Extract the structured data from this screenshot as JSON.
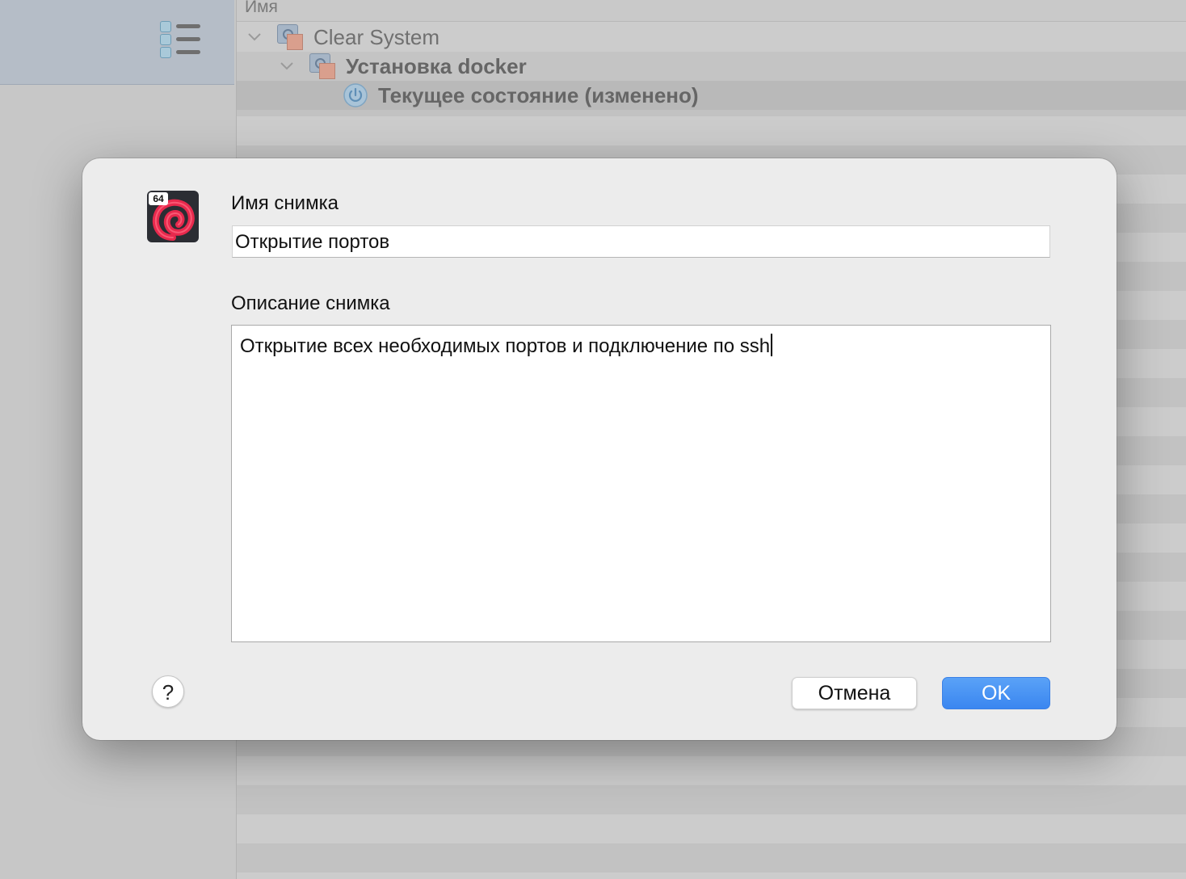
{
  "list": {
    "column_header": "Имя",
    "rows": [
      {
        "label": "Clear System"
      },
      {
        "label": "Установка docker"
      },
      {
        "label": "Текущее состояние (изменено)"
      }
    ]
  },
  "dialog": {
    "name_label": "Имя снимка",
    "name_value": "Открытие портов",
    "description_label": "Описание снимка",
    "description_value": "Открытие всех необходимых портов и подключение по ssh",
    "app_badge": "64",
    "help_label": "?",
    "cancel_label": "Отмена",
    "ok_label": "OK"
  },
  "colors": {
    "accent": "#3a86f0",
    "dialog_background": "#ececec",
    "window_background": "#c4c4c4"
  }
}
